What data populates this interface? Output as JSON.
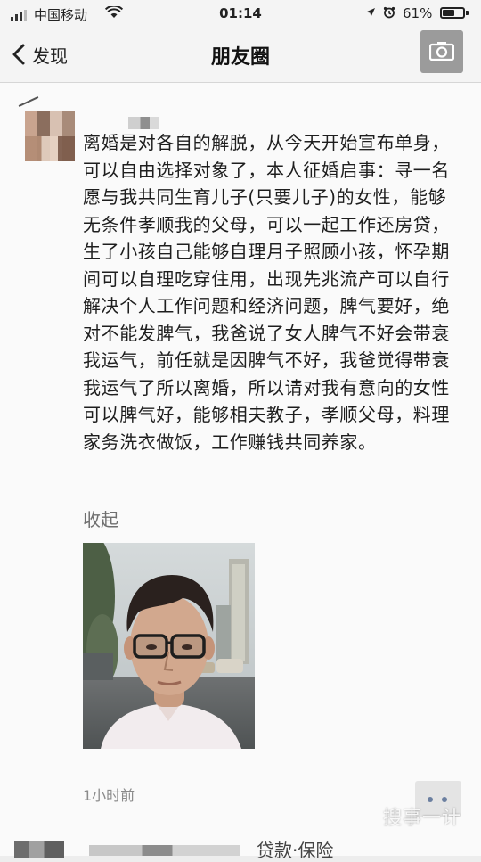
{
  "status_bar": {
    "carrier": "中国移动",
    "time": "01:14",
    "battery_percent": "61%",
    "battery_level": 0.61
  },
  "nav": {
    "back_label": "发现",
    "title": "朋友圈"
  },
  "post": {
    "text": "离婚是对各自的解脱，从今天开始宣布单身，可以自由选择对象了，本人征婚启事：寻一名愿与我共同生育儿子(只要儿子)的女性，能够无条件孝顺我的父母，可以一起工作还房贷，生了小孩自己能够自理月子照顾小孩，怀孕期间可以自理吃穿住用，出现先兆流产可以自行解决个人工作问题和经济问题，脾气要好，绝对不能发脾气，我爸说了女人脾气不好会带衰我运气，前任就是因脾气不好，我爸觉得带衰我运气了所以离婚，所以请对我有意向的女性可以脾气好，能够相夫教子，孝顺父母，料理家务洗衣做饭，工作赚钱共同养家。",
    "collapse_label": "收起",
    "time_ago": "1小时前"
  },
  "watermark": "搜事一计",
  "next_post": {
    "text": "贷款·保险"
  }
}
